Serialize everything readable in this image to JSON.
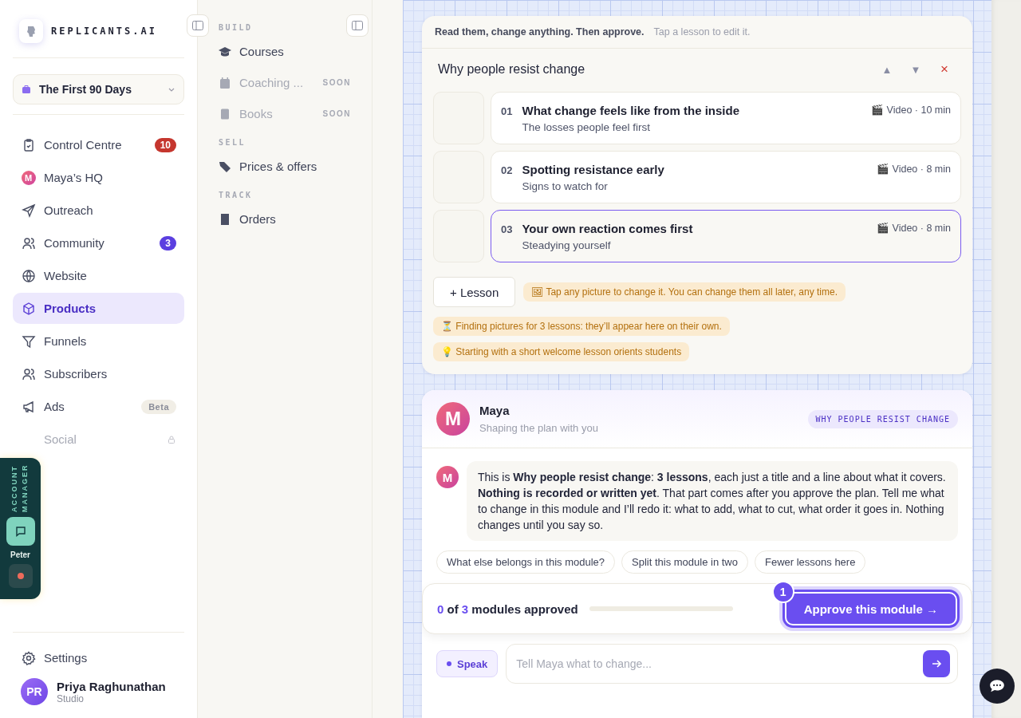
{
  "brand": {
    "name": "REPLICANTS.AI"
  },
  "workspace": {
    "name": "The First 90 Days"
  },
  "nav": [
    {
      "label": "Control Centre",
      "selected": false,
      "locked": false,
      "badge": {
        "text": "10",
        "kind": "alert"
      }
    },
    {
      "label": "Maya’s HQ",
      "selected": false,
      "locked": false,
      "avatar": "M"
    },
    {
      "label": "Outreach",
      "selected": false,
      "locked": false
    },
    {
      "label": "Community",
      "selected": false,
      "locked": false,
      "badge": {
        "text": "3",
        "kind": "count"
      }
    },
    {
      "label": "Website",
      "selected": false,
      "locked": false
    },
    {
      "label": "Products",
      "selected": true,
      "locked": false
    },
    {
      "label": "Funnels",
      "selected": false,
      "locked": false
    },
    {
      "label": "Subscribers",
      "selected": false,
      "locked": false
    },
    {
      "label": "Ads",
      "selected": false,
      "locked": false,
      "badge": {
        "text": "Beta",
        "kind": "tag"
      }
    },
    {
      "label": "Social",
      "selected": false,
      "locked": true
    }
  ],
  "settings": {
    "label": "Settings"
  },
  "user": {
    "initials": "PR",
    "name": "Priya Raghunathan",
    "plan": "Studio"
  },
  "account_manager": {
    "title": "ACCOUNT MANAGER",
    "name": "Peter"
  },
  "subnav": [
    {
      "title": "BUILD",
      "items": [
        {
          "label": "Courses",
          "disabled": false
        },
        {
          "label": "Coaching ...",
          "disabled": true,
          "tag": "SOON"
        },
        {
          "label": "Books",
          "disabled": true,
          "tag": "SOON"
        }
      ]
    },
    {
      "title": "SELL",
      "items": [
        {
          "label": "Prices & offers",
          "disabled": false
        }
      ]
    },
    {
      "title": "TRACK",
      "items": [
        {
          "label": "Orders",
          "disabled": false
        }
      ]
    }
  ],
  "plan": {
    "hint_strong": "Read them, change anything. Then approve.",
    "hint": "Tap a lesson to edit it.",
    "module_title": "Why people resist change",
    "module_controls": [
      {
        "symbol": "▲",
        "kind": "move"
      },
      {
        "symbol": "▼",
        "kind": "move"
      },
      {
        "symbol": "×",
        "kind": "delete"
      }
    ],
    "lessons": [
      {
        "number": "01",
        "title": "What change feels like from the inside",
        "subtitle": "The losses people feel first",
        "meta": "🎬 Video · 10 min",
        "selected": false
      },
      {
        "number": "02",
        "title": "Spotting resistance early",
        "subtitle": "Signs to watch for",
        "meta": "🎬 Video · 8 min",
        "selected": false
      },
      {
        "number": "03",
        "title": "Your own reaction comes first",
        "subtitle": "Steadying yourself",
        "meta": "🎬 Video · 8 min",
        "selected": true
      }
    ],
    "add_button": "+ Lesson",
    "tips": [
      "🖼 Tap any picture to change it. You can change them all later, any time.",
      "⏳ Finding pictures for 3 lessons: they’ll appear here on their own.",
      "💡 Starting with a short welcome lesson orients students"
    ]
  },
  "chat": {
    "agent": {
      "initial": "M",
      "name": "Maya",
      "status": "Shaping the plan with you"
    },
    "context_tag": "WHY PEOPLE RESIST CHANGE",
    "messages": [
      {
        "avatar": "M",
        "text": "This is **Why people resist change**: **3 lessons**, each just a title and a line about what it covers. **Nothing is recorded or written yet**. That part comes after you approve the plan. Tell me what to change in this module and I’ll redo it: what to add, what to cut, what order it goes in. Nothing changes until you say so."
      }
    ],
    "suggestions": [
      "What else belongs in this module?",
      "Split this module in two",
      "Fewer lessons here"
    ]
  },
  "progress": {
    "approved": "0",
    "of": "of",
    "total": "3",
    "label": "modules approved",
    "level": 0
  },
  "approve_button": {
    "label": "Approve this module →",
    "step": "1"
  },
  "composer": {
    "placeholder": "Tell Maya what to change..."
  },
  "speak_button": "Speak"
}
